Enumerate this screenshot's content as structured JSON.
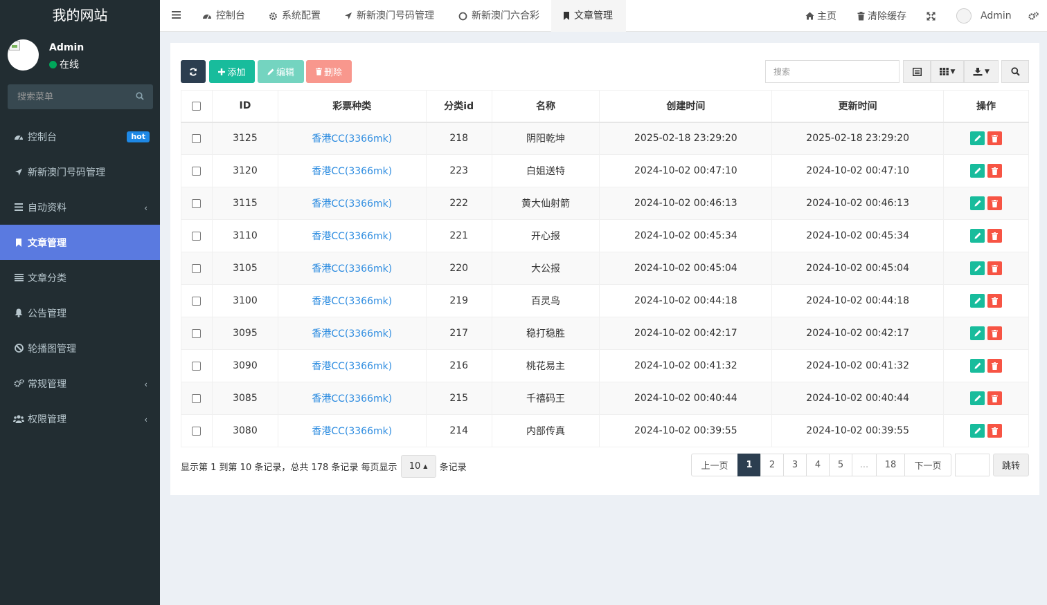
{
  "site": {
    "title": "我的网站"
  },
  "user": {
    "name": "Admin",
    "status": "在线"
  },
  "sidebar": {
    "search_placeholder": "搜索菜单",
    "items": [
      {
        "label": "控制台",
        "icon": "dashboard-icon",
        "badge": "hot"
      },
      {
        "label": "新新澳门号码管理",
        "icon": "location-arrow-icon"
      },
      {
        "label": "自动资料",
        "icon": "bars-icon",
        "expandable": true
      },
      {
        "label": "文章管理",
        "icon": "bookmark-icon",
        "active": true
      },
      {
        "label": "文章分类",
        "icon": "list-icon"
      },
      {
        "label": "公告管理",
        "icon": "bell-icon"
      },
      {
        "label": "轮播图管理",
        "icon": "slideshow-icon"
      },
      {
        "label": "常规管理",
        "icon": "cogs-icon",
        "expandable": true
      },
      {
        "label": "权限管理",
        "icon": "users-icon",
        "expandable": true
      }
    ]
  },
  "navbar": {
    "tabs": [
      {
        "label": "控制台",
        "icon": "dashboard-icon"
      },
      {
        "label": "系统配置",
        "icon": "cog-icon"
      },
      {
        "label": "新新澳门号码管理",
        "icon": "location-arrow-icon"
      },
      {
        "label": "新新澳门六合彩",
        "icon": "circle-icon"
      },
      {
        "label": "文章管理",
        "icon": "bookmark-icon",
        "active": true
      }
    ],
    "home": "主页",
    "clear_cache": "清除缓存",
    "user": "Admin"
  },
  "toolbar": {
    "add": "添加",
    "edit": "编辑",
    "delete": "删除",
    "search_placeholder": "搜索",
    "colors": {
      "refresh": "#2c3e50",
      "add": "#18bc9c",
      "edit": "#74d4c0",
      "delete": "#f8978d"
    }
  },
  "table": {
    "columns": [
      "ID",
      "彩票种类",
      "分类id",
      "名称",
      "创建时间",
      "更新时间",
      "操作"
    ],
    "rows": [
      {
        "id": "3125",
        "type": "香港CC(3366mk)",
        "cat": "218",
        "name": "阴阳乾坤",
        "created": "2025-02-18 23:29:20",
        "updated": "2025-02-18 23:29:20"
      },
      {
        "id": "3120",
        "type": "香港CC(3366mk)",
        "cat": "223",
        "name": "白姐送特",
        "created": "2024-10-02 00:47:10",
        "updated": "2024-10-02 00:47:10"
      },
      {
        "id": "3115",
        "type": "香港CC(3366mk)",
        "cat": "222",
        "name": "黄大仙射箭",
        "created": "2024-10-02 00:46:13",
        "updated": "2024-10-02 00:46:13"
      },
      {
        "id": "3110",
        "type": "香港CC(3366mk)",
        "cat": "221",
        "name": "开心报",
        "created": "2024-10-02 00:45:34",
        "updated": "2024-10-02 00:45:34"
      },
      {
        "id": "3105",
        "type": "香港CC(3366mk)",
        "cat": "220",
        "name": "大公报",
        "created": "2024-10-02 00:45:04",
        "updated": "2024-10-02 00:45:04"
      },
      {
        "id": "3100",
        "type": "香港CC(3366mk)",
        "cat": "219",
        "name": "百灵鸟",
        "created": "2024-10-02 00:44:18",
        "updated": "2024-10-02 00:44:18"
      },
      {
        "id": "3095",
        "type": "香港CC(3366mk)",
        "cat": "217",
        "name": "稳打稳胜",
        "created": "2024-10-02 00:42:17",
        "updated": "2024-10-02 00:42:17"
      },
      {
        "id": "3090",
        "type": "香港CC(3366mk)",
        "cat": "216",
        "name": "桃花易主",
        "created": "2024-10-02 00:41:32",
        "updated": "2024-10-02 00:41:32"
      },
      {
        "id": "3085",
        "type": "香港CC(3366mk)",
        "cat": "215",
        "name": "千禧码王",
        "created": "2024-10-02 00:40:44",
        "updated": "2024-10-02 00:40:44"
      },
      {
        "id": "3080",
        "type": "香港CC(3366mk)",
        "cat": "214",
        "name": "内部传真",
        "created": "2024-10-02 00:39:55",
        "updated": "2024-10-02 00:39:55"
      }
    ]
  },
  "pagination": {
    "info_prefix": "显示第 1 到第 10 条记录，总共 178 条记录 每页显示",
    "page_size": "10",
    "info_suffix": "条记录",
    "prev": "上一页",
    "pages": [
      "1",
      "2",
      "3",
      "4",
      "5",
      "...",
      "18"
    ],
    "current": "1",
    "next": "下一页",
    "jump": "跳转"
  }
}
